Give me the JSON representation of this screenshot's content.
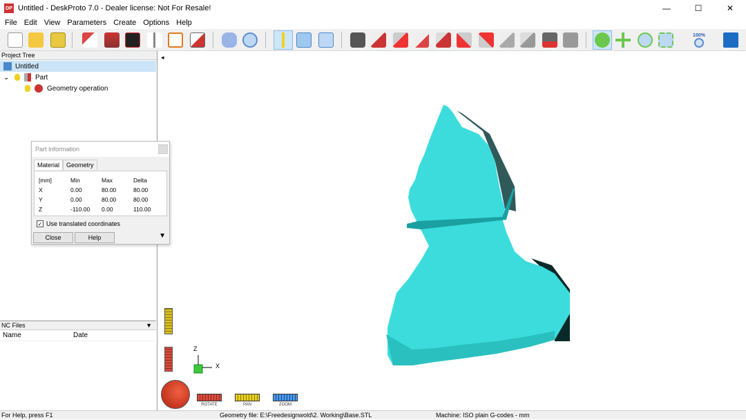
{
  "window": {
    "title": "Untitled - DeskProto 7.0 - Dealer license: Not For Resale!",
    "icon_text": "DP",
    "minimize": "—",
    "maximize": "☐",
    "close": "✕"
  },
  "menu": [
    "File",
    "Edit",
    "View",
    "Parameters",
    "Create",
    "Options",
    "Help"
  ],
  "toolbar": {
    "zoom_label": "100%"
  },
  "project_tree": {
    "header": "Project Tree",
    "items": [
      {
        "label": "Untitled"
      },
      {
        "label": "Part",
        "toggle": "⌄"
      },
      {
        "label": "Geometry operation"
      }
    ]
  },
  "nc_files": {
    "header": "NC Files",
    "dropdown": "▼",
    "col_name": "Name",
    "col_date": "Date"
  },
  "dialog": {
    "title": "Part Information",
    "tabs": [
      "Material",
      "Geometry"
    ],
    "table": {
      "headers": [
        "[mm]",
        "Min",
        "Max",
        "Delta"
      ],
      "rows": [
        [
          "X",
          "0.00",
          "80.00",
          "80.00"
        ],
        [
          "Y",
          "0.00",
          "80.00",
          "80.00"
        ],
        [
          "Z",
          "-110.00",
          "0.00",
          "110.00"
        ]
      ]
    },
    "checkbox_label": "Use translated coordinates",
    "checkbox_mark": "✓",
    "close_label": "Close",
    "help_label": "Help",
    "more_arrow": "▼"
  },
  "viewport": {
    "collapse_arrow": "◂",
    "axis_z": "Z",
    "axis_x": "X",
    "modes": {
      "rotate": "ROTATE",
      "pan": "PAN",
      "zoom": "ZOOM"
    },
    "model_color": "#3cdcdc"
  },
  "status": {
    "help": "For Help, press F1",
    "geometry": "Geometry file: E:\\Freedesignwold\\2. Working\\Base.STL",
    "machine": "Machine: ISO plain G-codes - mm"
  }
}
